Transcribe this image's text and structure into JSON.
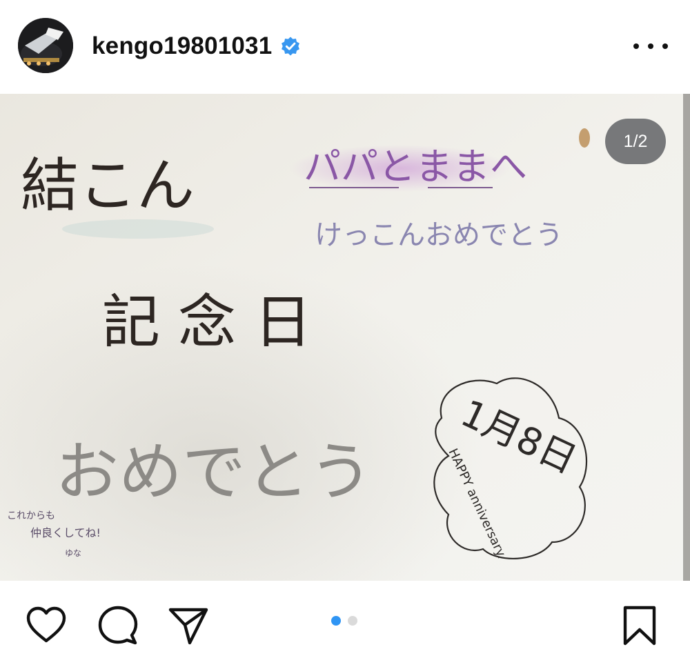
{
  "post": {
    "username": "kengo19801031",
    "counter": "1/2",
    "slides_total": 2,
    "active_slide": 1
  },
  "icons": {
    "verified": "verified-badge-icon",
    "more": "more-options-icon",
    "like": "heart-icon",
    "comment": "comment-icon",
    "share": "send-icon",
    "save": "bookmark-icon"
  },
  "colors": {
    "verified": "#3897f0",
    "active_dot": "#2f95f4",
    "inactive_dot": "#dadada",
    "paper": "#f3f2ed"
  },
  "photo": {
    "main_title_line1": "結こん",
    "main_title_line2": "記念日",
    "to_line": "パパとままへ",
    "congrats_small": "けっこんおめでとう",
    "congrats_big": "おめでとう",
    "date": "1月8日",
    "happy_anniversary": "HAPPY anniversary.",
    "note_line1": "これからも",
    "note_line2": "仲良くしてね!",
    "signature": "ゆな"
  }
}
